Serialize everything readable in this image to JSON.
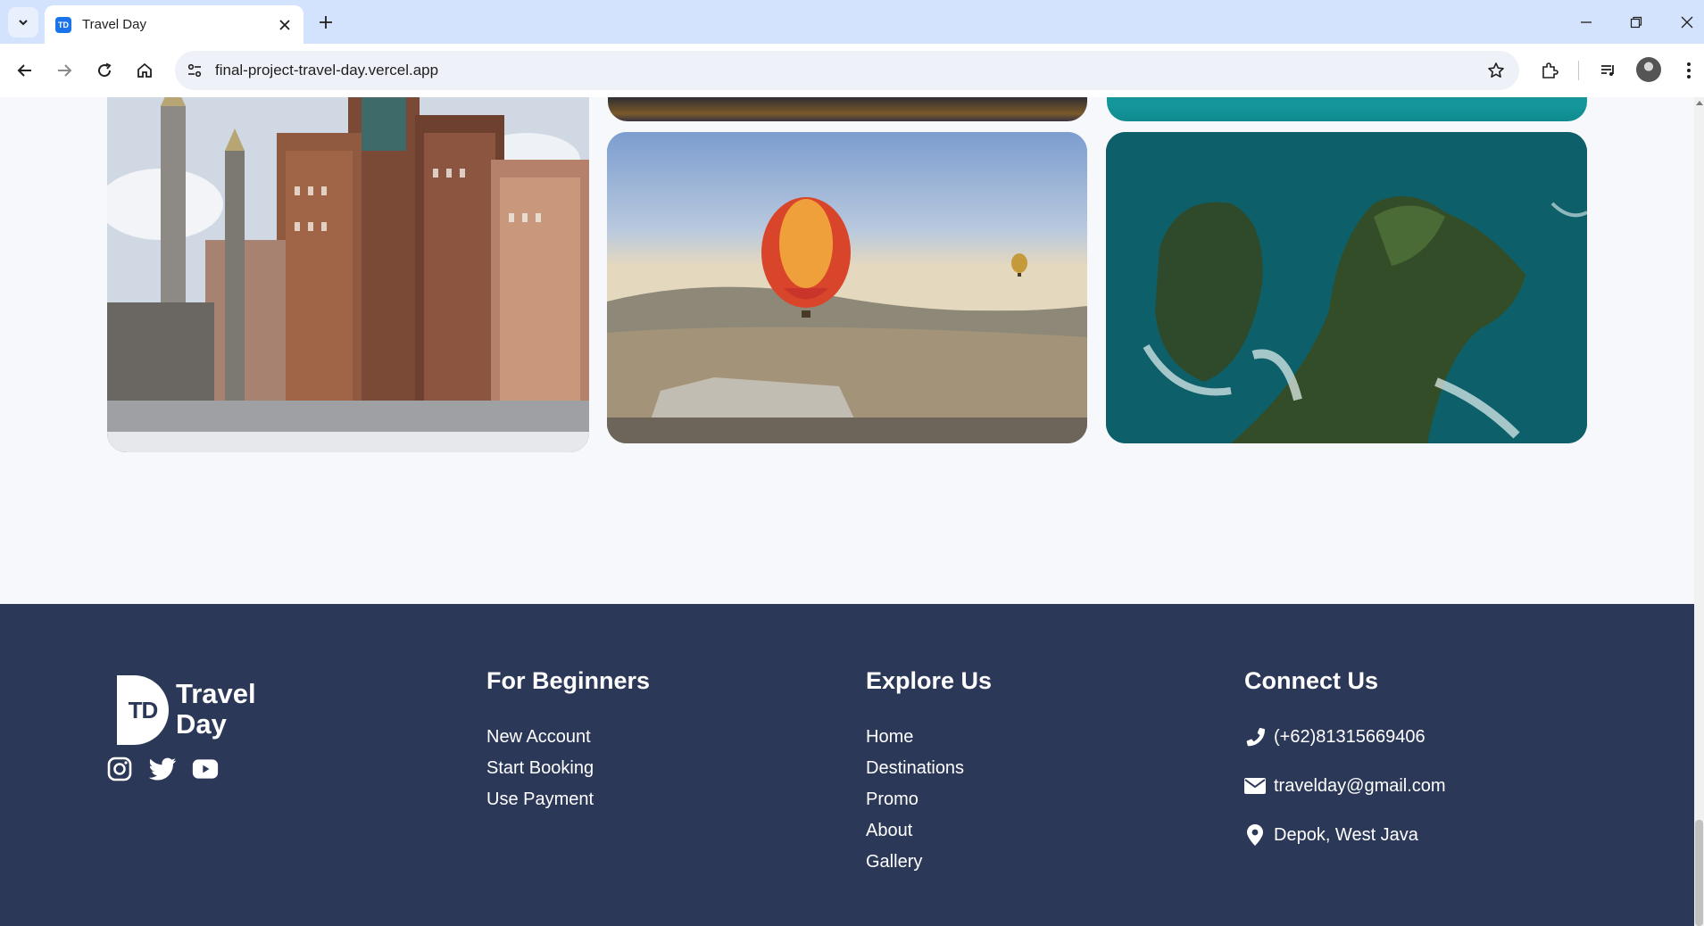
{
  "browser": {
    "tab_title": "Travel Day",
    "tab_favicon_text": "TD",
    "url": "final-project-travel-day.vercel.app"
  },
  "gallery": {
    "images": [
      {
        "name": "mecca-clock-towers"
      },
      {
        "name": "hot-air-balloons"
      },
      {
        "name": "sea-cliff-island"
      }
    ]
  },
  "footer": {
    "logo": {
      "badge": "TD",
      "line1": "Travel",
      "line2": "Day"
    },
    "socials": [
      "instagram-icon",
      "twitter-icon",
      "youtube-icon"
    ],
    "columns": {
      "beginners": {
        "title": "For Beginners",
        "links": [
          "New Account",
          "Start Booking",
          "Use Payment"
        ]
      },
      "explore": {
        "title": "Explore Us",
        "links": [
          "Home",
          "Destinations",
          "Promo",
          "About",
          "Gallery"
        ]
      },
      "connect": {
        "title": "Connect Us",
        "phone": "(+62)81315669406",
        "email": "travelday@gmail.com",
        "location": "Depok, West Java"
      }
    }
  },
  "colors": {
    "footer_bg": "#2c3857",
    "page_bg": "#f7f8fc",
    "tabbar_bg": "#d3e3fd"
  }
}
